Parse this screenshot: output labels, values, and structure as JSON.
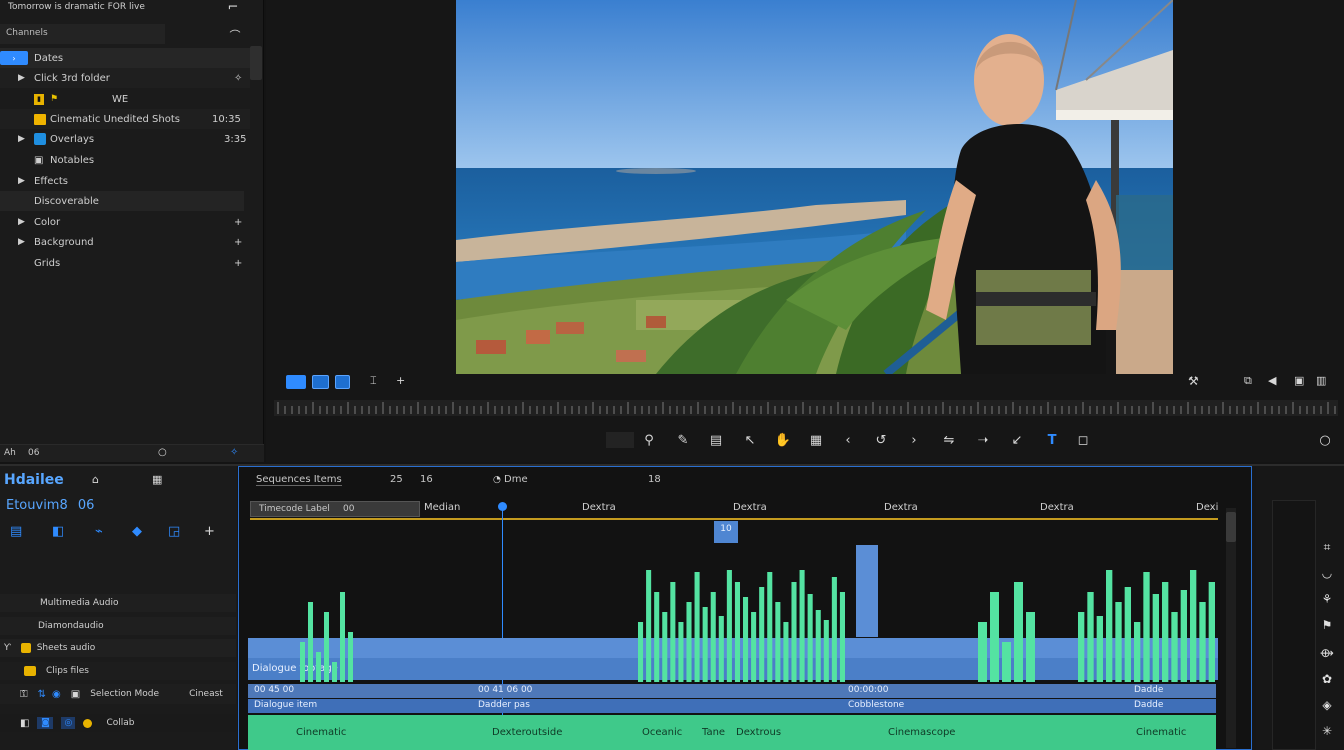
{
  "project_panel": {
    "title": "Tomorrow is dramatic FOR live",
    "search_text": "Channels",
    "items": [
      {
        "label": "Dates",
        "value": ""
      },
      {
        "label": "Click 3rd folder",
        "value": ""
      },
      {
        "label": "",
        "value": "WE"
      },
      {
        "label": "Cinematic Unedited Shots",
        "value": "10:35"
      },
      {
        "label": "Overlays",
        "value": "3:35"
      },
      {
        "label": "Notables",
        "value": ""
      },
      {
        "label": "Effects",
        "value": ""
      },
      {
        "label": "Discoverable",
        "value": ""
      },
      {
        "label": "Color",
        "value": ""
      },
      {
        "label": "Background",
        "value": ""
      },
      {
        "label": "Grids",
        "value": ""
      }
    ],
    "footer_left": "Ah",
    "footer_mid": "06"
  },
  "program_monitor": {
    "source": "Seaside portrait frame"
  },
  "timeline": {
    "panel_title": "Hdailee",
    "sequence_label": "Etouvim8",
    "sequence_suffix": "06",
    "tabs": [
      "Sequences Items",
      "25",
      "16"
    ],
    "timecode_label": "Dme",
    "extra_tab": "18",
    "in_label": "Timecode Label",
    "in_value": "00",
    "ruler": [
      "Median",
      "Dextra",
      "Dextra",
      "Dextra",
      "Dextra",
      "Dexi"
    ],
    "marker": "10",
    "audio_tracks": [
      "Multimedia Audio",
      "Diamondaudio",
      "Sheets audio",
      "Clips files"
    ],
    "track_header_labels": [
      "Selection Mode",
      "Cineast",
      "Collab"
    ],
    "video_clip_text": "Dialogue footage",
    "clip_labels_row1": [
      "00 45 00",
      "00 41 06 00",
      "00:00:00",
      "Dadde"
    ],
    "clip_labels_row2": [
      "Dialogue item",
      "Dadder pas",
      "Cobblestone",
      "Dadde"
    ],
    "green_labels": [
      "Cinematic",
      "Dexteroutside",
      "Oceanic",
      "Tane",
      "Dextrous",
      "Cinemascope",
      "Cinematic"
    ]
  },
  "colors": {
    "accent": "#2f8bff",
    "clip_blue": "#5b8ed6",
    "audio_green": "#4fe0a0",
    "panel": "#1c1c1c"
  }
}
